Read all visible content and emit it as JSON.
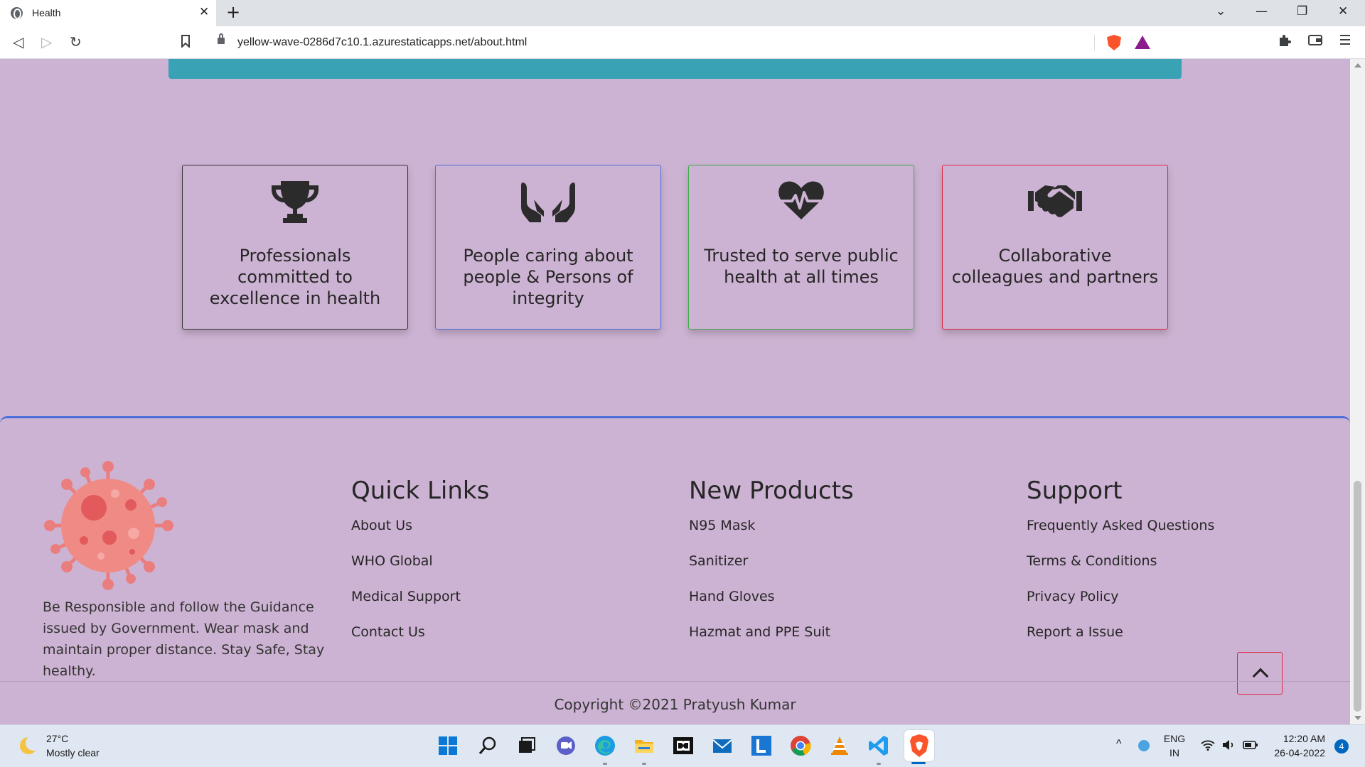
{
  "browser": {
    "tab_title": "Health",
    "tab_close": "✕",
    "new_tab": "+",
    "url": "yellow-wave-0286d7c10.1.azurestaticapps.net/about.html",
    "window_controls": [
      "⌄",
      "—",
      "❐",
      "✕"
    ],
    "nav": {
      "back": "◁",
      "forward": "▷",
      "reload": "↻",
      "bookmark": "🔖"
    },
    "toolbar_icons": [
      "puzzle-icon",
      "wallet-icon",
      "menu-icon"
    ]
  },
  "values_cards": [
    {
      "icon": "trophy-icon",
      "text": "Professionals committed to excellence in health",
      "border_color": "#333333"
    },
    {
      "icon": "caring-hands-icon",
      "text": "People caring about people & Persons of integrity",
      "border_color": "#4c6fdb"
    },
    {
      "icon": "heartbeat-icon",
      "text": "Trusted to serve public health at all times",
      "border_color": "#3faa45"
    },
    {
      "icon": "handshake-icon",
      "text": "Collaborative colleagues and partners",
      "border_color": "#e0263f"
    }
  ],
  "footer": {
    "logo_icon": "virus-icon",
    "about": "Be Responsible and follow the Guidance issued by Government. Wear mask and maintain proper distance. Stay Safe, Stay healthy.",
    "quick_links": {
      "title": "Quick Links",
      "items": [
        "About Us",
        "WHO Global",
        "Medical Support",
        "Contact Us"
      ]
    },
    "new_products": {
      "title": "New Products",
      "items": [
        "N95 Mask",
        "Sanitizer",
        "Hand Gloves",
        "Hazmat and PPE Suit"
      ]
    },
    "support": {
      "title": "Support",
      "items": [
        "Frequently Asked Questions",
        "Terms & Conditions",
        "Privacy Policy",
        "Report a Issue"
      ]
    },
    "copyright": "Copyright ©2021 Pratyush Kumar",
    "back_to_top_icon": "chevron-up-icon"
  },
  "taskbar": {
    "weather_temp": "27°C",
    "weather_desc": "Mostly clear",
    "language_line1": "ENG",
    "language_line2": "IN",
    "time": "12:20 AM",
    "date": "26-04-2022",
    "notification_count": "4"
  },
  "colors": {
    "page_bg": "#cdb3d3",
    "banner": "#39a2b5",
    "footer_border": "#4c6fdb",
    "back_to_top_border": "#e0263f"
  }
}
